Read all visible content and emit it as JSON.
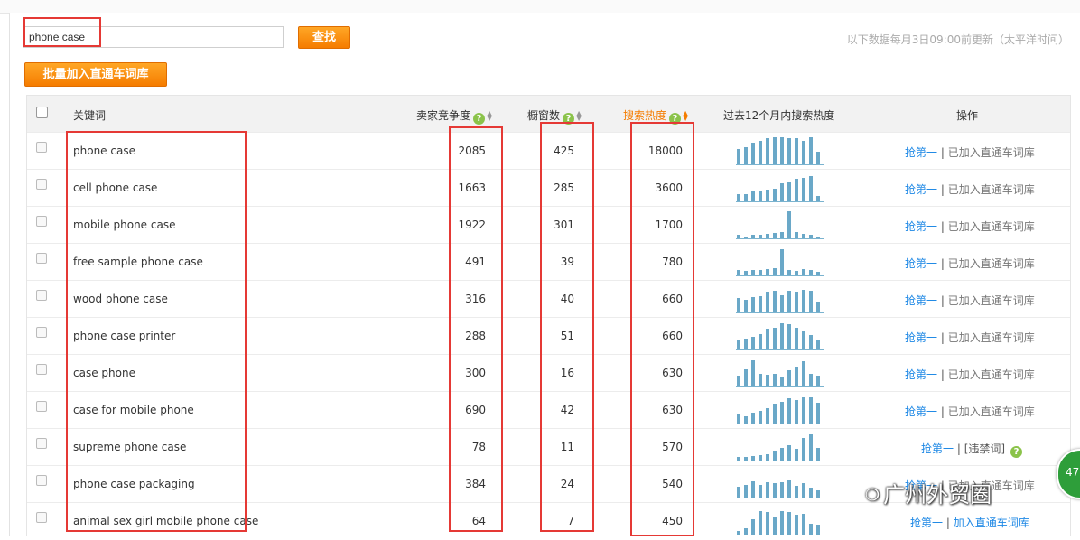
{
  "search": {
    "value": "phone case",
    "button_label": "查找"
  },
  "update_note": "以下数据每月3日09:00前更新（太平洋时间）",
  "batch_button_label": "批量加入直通车词库",
  "columns": {
    "keyword": "关键词",
    "competition": "卖家竞争度",
    "showcase": "橱窗数",
    "search_heat": "搜索热度",
    "trend": "过去12个月内搜索热度",
    "actions": "操作"
  },
  "help_icon_glyph": "?",
  "rows": [
    {
      "keyword": "phone case",
      "competition": "2085",
      "showcase": "425",
      "heat": "18000",
      "trend": [
        14,
        16,
        20,
        22,
        24,
        25,
        25,
        24,
        24,
        22,
        25,
        12
      ],
      "op_link": "抢第一",
      "op_sep": " | ",
      "op_status": "已加入直通车词库"
    },
    {
      "keyword": "cell phone case",
      "competition": "1663",
      "showcase": "285",
      "heat": "3600",
      "trend": [
        7,
        7,
        9,
        10,
        11,
        12,
        17,
        18,
        21,
        22,
        23,
        5
      ],
      "op_link": "抢第一",
      "op_sep": " | ",
      "op_status": "已加入直通车词库"
    },
    {
      "keyword": "mobile phone case",
      "competition": "1922",
      "showcase": "301",
      "heat": "1700",
      "trend": [
        3,
        2,
        3,
        3,
        4,
        5,
        6,
        25,
        6,
        4,
        3,
        2
      ],
      "op_link": "抢第一",
      "op_sep": " | ",
      "op_status": "已加入直通车词库"
    },
    {
      "keyword": "free sample phone case",
      "competition": "491",
      "showcase": "39",
      "heat": "780",
      "trend": [
        5,
        4,
        5,
        5,
        6,
        7,
        24,
        5,
        4,
        6,
        5,
        3
      ],
      "op_link": "抢第一",
      "op_sep": " | ",
      "op_status": "已加入直通车词库"
    },
    {
      "keyword": "wood phone case",
      "competition": "316",
      "showcase": "40",
      "heat": "660",
      "trend": [
        13,
        12,
        14,
        15,
        19,
        20,
        16,
        20,
        19,
        21,
        20,
        10
      ],
      "op_link": "抢第一",
      "op_sep": " | ",
      "op_status": "已加入直通车词库"
    },
    {
      "keyword": "phone case printer",
      "competition": "288",
      "showcase": "51",
      "heat": "660",
      "trend": [
        8,
        10,
        12,
        14,
        19,
        20,
        24,
        23,
        20,
        17,
        13,
        9
      ],
      "op_link": "抢第一",
      "op_sep": " | ",
      "op_status": "已加入直通车词库"
    },
    {
      "keyword": "case phone",
      "competition": "300",
      "showcase": "16",
      "heat": "630",
      "trend": [
        10,
        16,
        24,
        12,
        11,
        12,
        9,
        15,
        18,
        23,
        12,
        10
      ],
      "op_link": "抢第一",
      "op_sep": " | ",
      "op_status": "已加入直通车词库"
    },
    {
      "keyword": "case for mobile phone",
      "competition": "690",
      "showcase": "42",
      "heat": "630",
      "trend": [
        8,
        7,
        10,
        12,
        14,
        18,
        20,
        23,
        22,
        24,
        24,
        19
      ],
      "op_link": "抢第一",
      "op_sep": " | ",
      "op_status": "已加入直通车词库"
    },
    {
      "keyword": "supreme phone case",
      "competition": "78",
      "showcase": "11",
      "heat": "570",
      "trend": [
        3,
        3,
        4,
        5,
        6,
        9,
        12,
        14,
        11,
        21,
        24,
        12
      ],
      "op_link": "抢第一",
      "op_sep": " | ",
      "op_status": "[违禁词]"
    },
    {
      "keyword": "phone case packaging",
      "competition": "384",
      "showcase": "24",
      "heat": "540",
      "trend": [
        10,
        12,
        15,
        12,
        14,
        13,
        14,
        16,
        11,
        13,
        9,
        7
      ],
      "op_link": "抢第一",
      "op_sep": " | ",
      "op_status": "已加入直通车词库"
    },
    {
      "keyword": "animal sex girl mobile phone case",
      "competition": "64",
      "showcase": "7",
      "heat": "450",
      "trend": [
        3,
        6,
        14,
        22,
        21,
        17,
        22,
        21,
        18,
        19,
        10,
        9
      ],
      "op_link": "抢第一",
      "op_sep": " | ",
      "op_status": "加入直通车词库"
    }
  ],
  "badge_text": "47",
  "watermark": {
    "text": "广州外贸圈"
  },
  "colors": {
    "accent": "#f57c00",
    "link": "#1e88e5",
    "bar": "#6aa8c8",
    "highlight_box": "#e53935",
    "help_icon": "#8bc34a"
  }
}
